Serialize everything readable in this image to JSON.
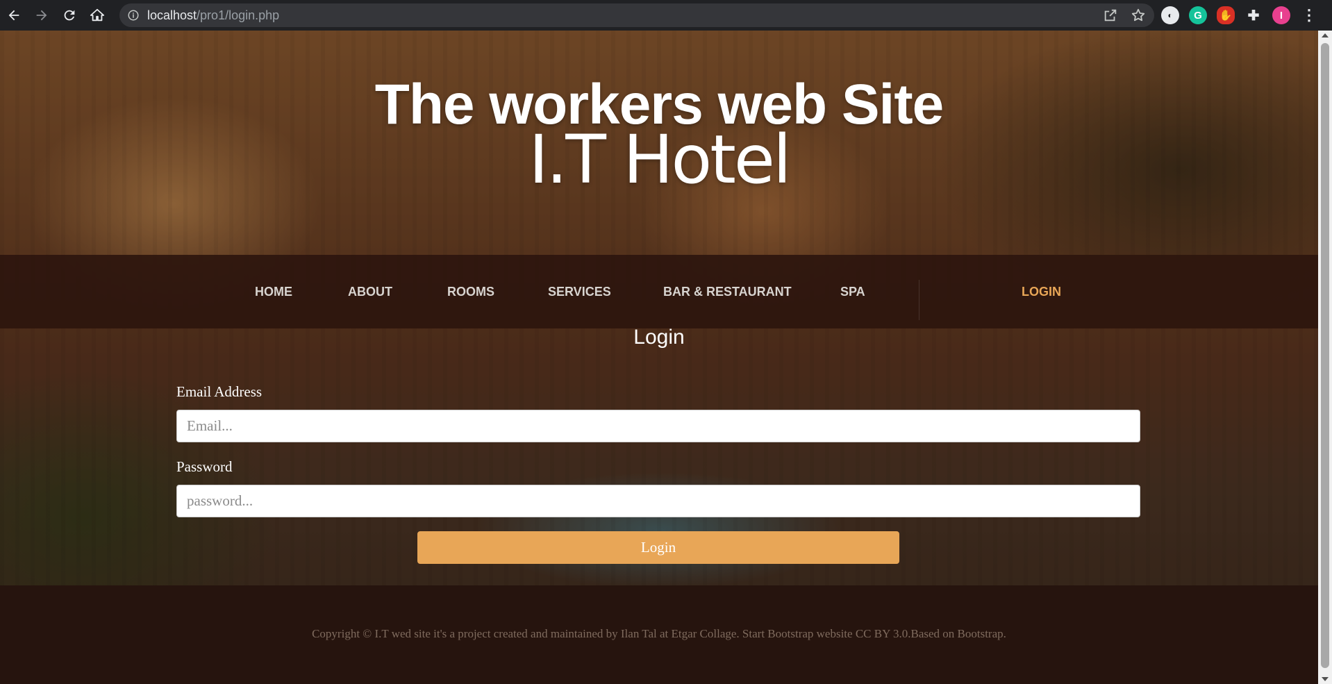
{
  "browser": {
    "url_host": "localhost",
    "url_path": "/pro1/login.php",
    "profile_initial": "I"
  },
  "hero": {
    "title": "The workers web Site",
    "subtitle": "I.T Hotel"
  },
  "nav": {
    "items": [
      {
        "label": "Home"
      },
      {
        "label": "About"
      },
      {
        "label": "Rooms"
      },
      {
        "label": "Services"
      },
      {
        "label": "Bar & Restaurant"
      },
      {
        "label": "Spa"
      },
      {
        "label": "Login"
      }
    ],
    "active_color": "#e8a657"
  },
  "login": {
    "heading": "Login",
    "email_label": "Email Address",
    "email_placeholder": "Email...",
    "password_label": "Password",
    "password_placeholder": "password...",
    "submit_label": "Login"
  },
  "footer": {
    "text": "Copyright © I.T wed site it's a project created and maintained by Ilan Tal at Etgar Collage. Start Bootstrap website CC BY 3.0.Based on Bootstrap."
  },
  "colors": {
    "accent": "#e8a657",
    "navbar_bg": "#2d160e",
    "footer_bg": "#26140e"
  }
}
